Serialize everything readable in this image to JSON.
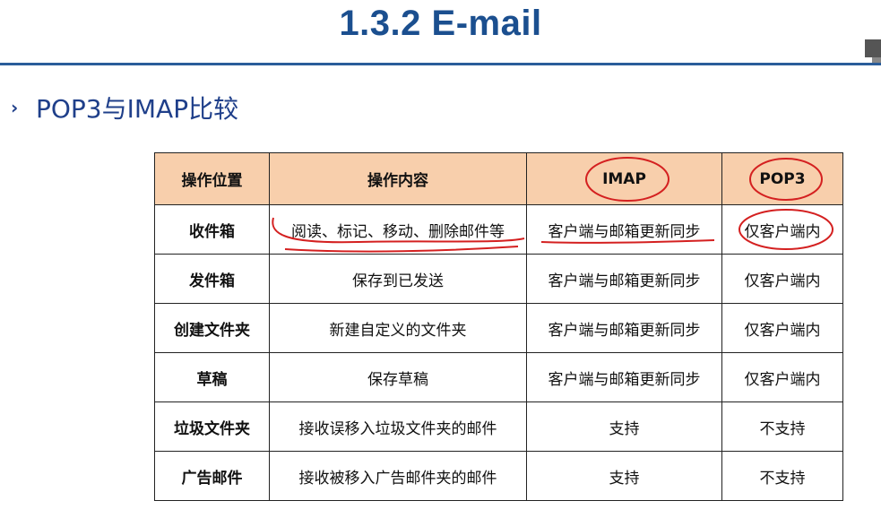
{
  "slide": {
    "title": "1.3.2  E-mail",
    "heading": "POP3与IMAP比较",
    "bullet": "›"
  },
  "table": {
    "headers": [
      "操作位置",
      "操作内容",
      "IMAP",
      "POP3"
    ],
    "rows": [
      [
        "收件箱",
        "阅读、标记、移动、删除邮件等",
        "客户端与邮箱更新同步",
        "仅客户端内"
      ],
      [
        "发件箱",
        "保存到已发送",
        "客户端与邮箱更新同步",
        "仅客户端内"
      ],
      [
        "创建文件夹",
        "新建自定义的文件夹",
        "客户端与邮箱更新同步",
        "仅客户端内"
      ],
      [
        "草稿",
        "保存草稿",
        "客户端与邮箱更新同步",
        "仅客户端内"
      ],
      [
        "垃圾文件夹",
        "接收误移入垃圾文件夹的邮件",
        "支持",
        "不支持"
      ],
      [
        "广告邮件",
        "接收被移入广告邮件夹的邮件",
        "支持",
        "不支持"
      ]
    ]
  },
  "colors": {
    "title": "#1b4f8f",
    "header_bg": "#f8cfac",
    "annotation": "#d42020"
  }
}
